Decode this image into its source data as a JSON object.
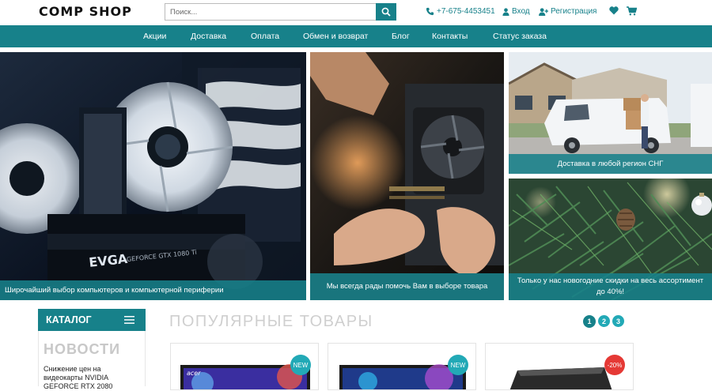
{
  "header": {
    "logo": "COMP SHOP",
    "search_placeholder": "Поиск...",
    "phone": "+7-675-4453451",
    "login": "Вход",
    "register": "Регистрация"
  },
  "nav": {
    "items": [
      "Акции",
      "Доставка",
      "Оплата",
      "Обмен и возврат",
      "Блог",
      "Контакты",
      "Статус заказа"
    ]
  },
  "banners": {
    "computers": "Широчайший выбор компьютеров и компьютерной периферии",
    "help": "Мы всегда рады помочь Вам в выборе товара",
    "delivery": "Доставка в любой регион СНГ",
    "newyear": "Только у нас новогодние скидки на весь ассортимент до 40%!"
  },
  "sidebar": {
    "catalog_label": "КАТАЛОГ",
    "news_title": "НОВОСТИ",
    "news_item": "Снижение цен на видеокарты NVIDIA GEFORCE RTX 2080"
  },
  "popular": {
    "title": "ПОПУЛЯРНЫЕ ТОВАРЫ",
    "pages": [
      "1",
      "2",
      "3"
    ],
    "badges": [
      "NEW",
      "NEW",
      "-20%"
    ],
    "card_brand": "acer"
  },
  "colors": {
    "brand": "#17818a",
    "badge_new": "#22a9b6",
    "badge_sale": "#e53935",
    "dot_active": "#17818a",
    "dot_inactive": "#22a9b6"
  }
}
